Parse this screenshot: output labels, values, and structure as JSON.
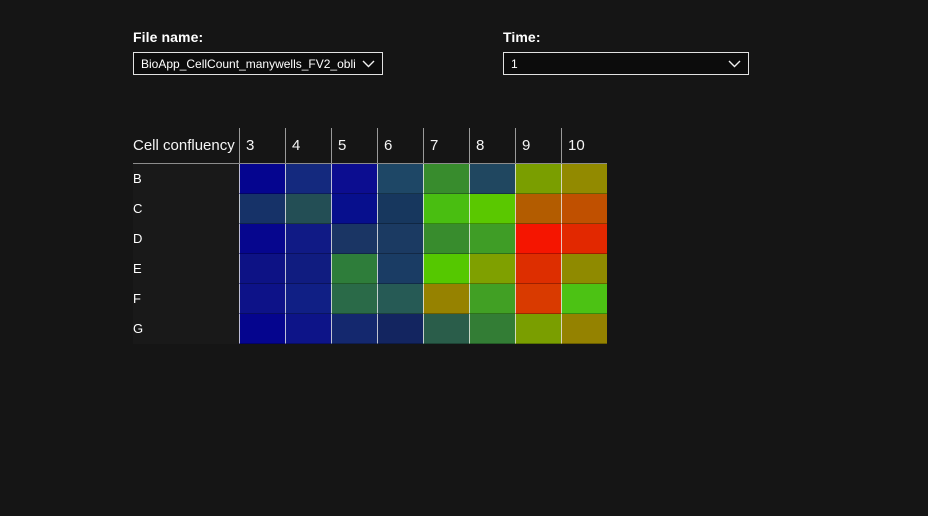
{
  "page": {
    "background_color": "#151515"
  },
  "controls": {
    "file_name": {
      "label": "File name:",
      "value": "BioApp_CellCount_manywells_FV2_obliqu...",
      "icon": "chevron-down"
    },
    "time": {
      "label": "Time:",
      "value": "1",
      "icon": "chevron-down"
    }
  },
  "chart_data": {
    "type": "heatmap",
    "corner_label": "Cell confluency",
    "columns": [
      "3",
      "4",
      "5",
      "6",
      "7",
      "8",
      "9",
      "10"
    ],
    "rows": [
      "B",
      "C",
      "D",
      "E",
      "F",
      "G"
    ],
    "legend": "none",
    "color_scale_hint": "blue=low, green=mid, red=high",
    "cell_colors": [
      [
        "#05058F",
        "#14297E",
        "#0C0D90",
        "#1E4766",
        "#388C2D",
        "#204760",
        "#7A9E00",
        "#928A00"
      ],
      [
        "#163268",
        "#234E55",
        "#070F8D",
        "#17375E",
        "#49BE11",
        "#5AC800",
        "#B35C00",
        "#C05000"
      ],
      [
        "#06068E",
        "#101A85",
        "#1A3564",
        "#1B3A62",
        "#388C2D",
        "#3F9D26",
        "#F51500",
        "#E22800"
      ],
      [
        "#0D1285",
        "#101C80",
        "#2E7D3A",
        "#1A3C64",
        "#55C800",
        "#7FA000",
        "#DD2E00",
        "#8F8A00"
      ],
      [
        "#0D1288",
        "#101F85",
        "#2A6A48",
        "#265A55",
        "#968200",
        "#41A024",
        "#D93A00",
        "#4CC214"
      ],
      [
        "#05058E",
        "#0D1488",
        "#14286E",
        "#132560",
        "#2A5D4A",
        "#337D35",
        "#7A9E00",
        "#948200"
      ]
    ]
  }
}
